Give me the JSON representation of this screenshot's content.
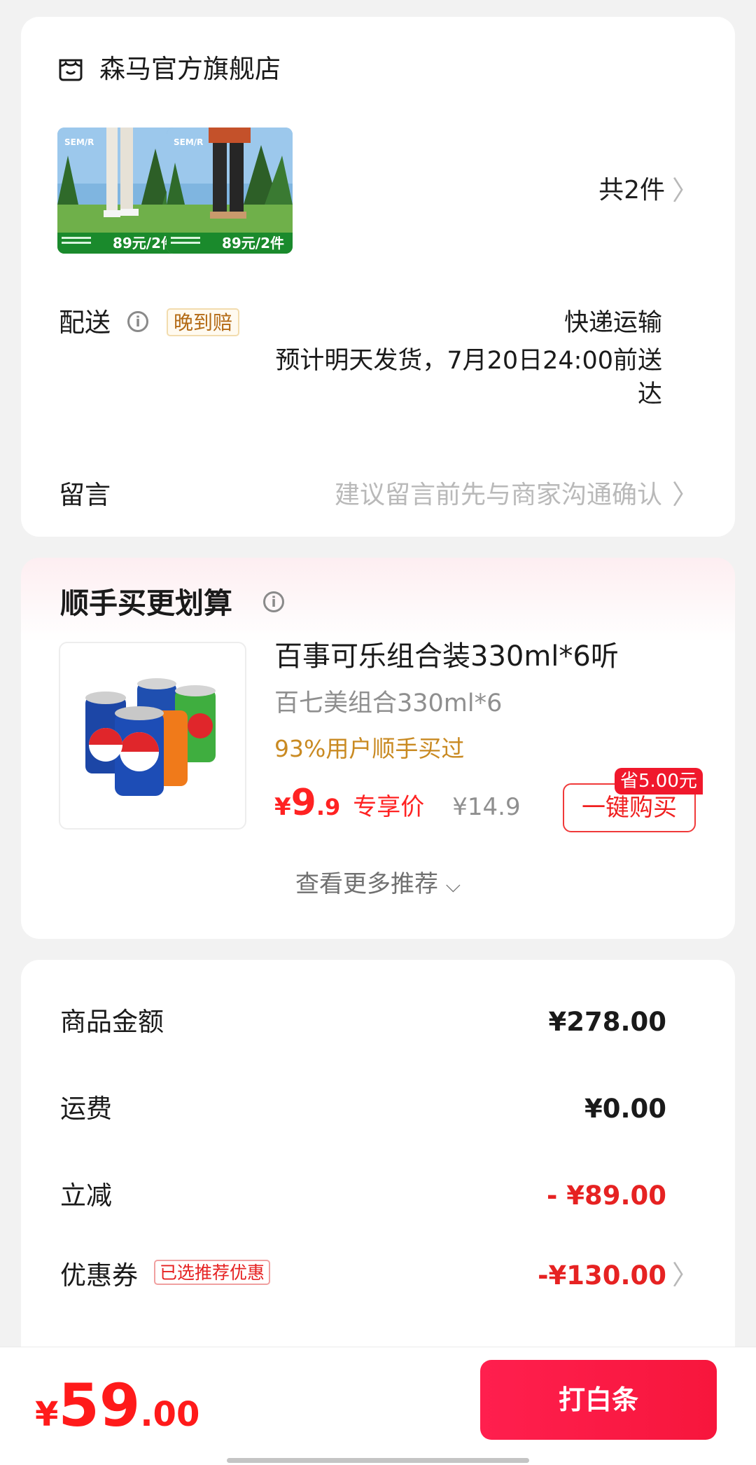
{
  "store": {
    "name": "森马官方旗舰店",
    "icon": "store-icon",
    "items": [
      {
        "brand": "SEM/R",
        "badge": "89元/2件"
      },
      {
        "brand": "SEM/R",
        "badge": "89元/2件"
      }
    ],
    "count_label": "共2件",
    "delivery_label": "配送",
    "late_compensation": "晚到赔",
    "shipping_method": "快递运输",
    "shipping_eta_line1": "预计明天发货，7月20日24:00前送",
    "shipping_eta_line2": "达",
    "message_label": "留言",
    "message_placeholder": "建议留言前先与商家沟通确认"
  },
  "recommend": {
    "title": "顺手买更划算",
    "product": {
      "name": "百事可乐组合装330ml*6听",
      "sub": "百七美组合330ml*6",
      "buyers": "93%用户顺手买过",
      "price_symbol": "¥",
      "price_int": "9",
      "price_dec": ".9",
      "price_tag": "专享价",
      "original_price": "¥14.9",
      "save_badge": "省5.00元",
      "buy_button": "一键购买"
    },
    "more": "查看更多推荐"
  },
  "summary": {
    "rows": [
      {
        "label": "商品金额",
        "value": "¥278.00"
      },
      {
        "label": "运费",
        "value": "¥0.00"
      },
      {
        "label": "立减",
        "value": "- ¥89.00"
      },
      {
        "label": "优惠券",
        "badge": "已选推荐优惠",
        "value": "-¥130.00"
      }
    ]
  },
  "bottom": {
    "total_symbol": "¥",
    "total_int": "59",
    "total_dec": ".00",
    "pay_button": "打白条"
  },
  "colors": {
    "accent_red": "#ff1a1a",
    "badge_gold": "#c98a22",
    "page_bg": "#f2f2f2"
  }
}
